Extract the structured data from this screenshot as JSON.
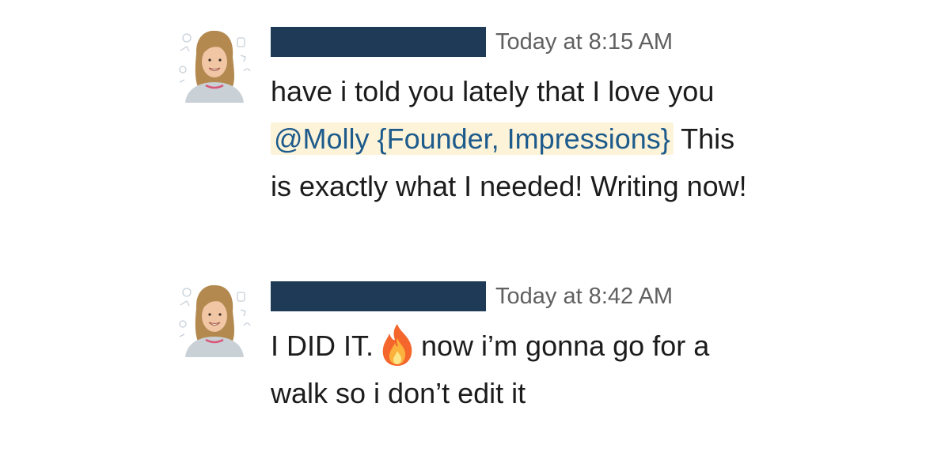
{
  "messages": [
    {
      "timestamp": "Today at 8:15 AM",
      "text_before": "have i told you lately that I love you ",
      "mention": "@Molly {Founder, Impressions}",
      "text_after": " This is exactly what I needed! Writing now!"
    },
    {
      "timestamp": "Today at 8:42 AM",
      "text_before": "I DID IT.",
      "emoji": "fire-emoji",
      "text_after": "now i’m gonna go for a walk so i don’t edit it"
    }
  ],
  "colors": {
    "redaction": "#1e3a56",
    "mention_text": "#1d5b8c",
    "mention_bg": "#fdf3d8",
    "timestamp": "#616061"
  },
  "icons": {
    "avatar": "avatar-photo",
    "emoji": "fire-icon"
  }
}
